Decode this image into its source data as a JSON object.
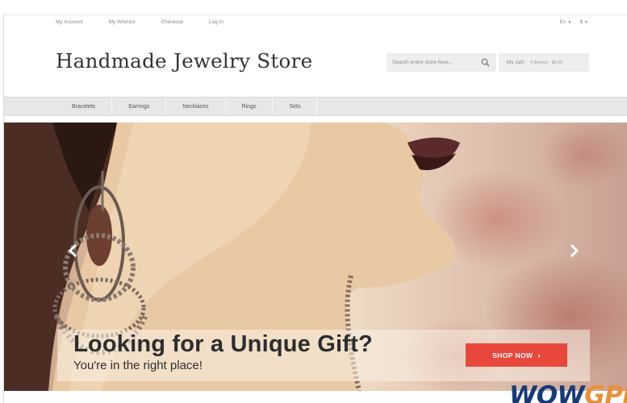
{
  "header": {
    "top_links": [
      "My Account",
      "My Wishlist",
      "Checkout",
      "Log In"
    ],
    "language": "En",
    "currency": "$"
  },
  "logo": "Handmade Jewelry Store",
  "search": {
    "placeholder": "Search entire store here..."
  },
  "cart": {
    "label": "My cart",
    "summary": "0 item(s) - $0.00"
  },
  "nav": [
    "Bracelets",
    "Earrings",
    "Necklaces",
    "Rings",
    "Sets"
  ],
  "hero": {
    "headline": "Looking for a Unique Gift?",
    "subline": "You're in the right place!",
    "cta": "SHOP NOW",
    "cta_icon": "chevron-right-icon",
    "prev_icon": "chevron-left-icon",
    "next_icon": "chevron-right-icon"
  },
  "watermark": {
    "part1": "WOW",
    "part2": "GPL"
  },
  "colors": {
    "cta": "#e8483c",
    "nav_bg": "#e7e7e7",
    "watermark_blue": "#163a7a",
    "watermark_orange": "#e8913a"
  }
}
